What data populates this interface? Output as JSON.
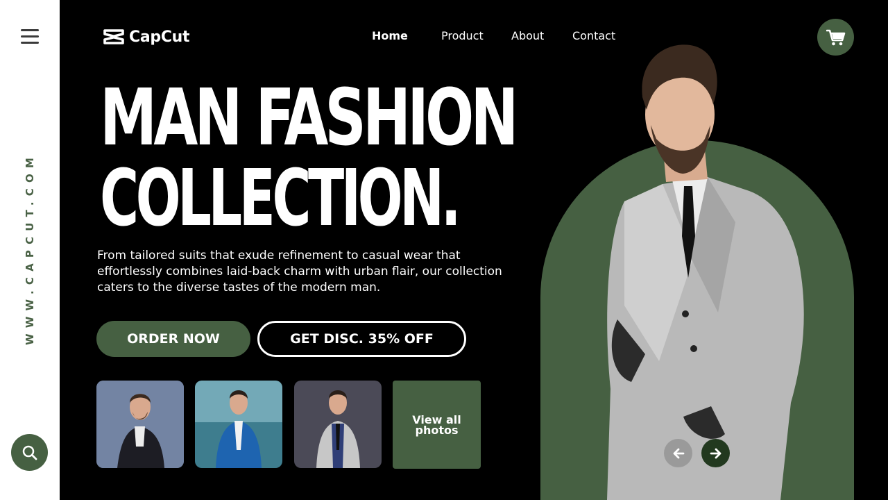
{
  "sidebar": {
    "vertical_url": "WWW.CAPCUT.COM",
    "menu_icon": "hamburger-menu-icon",
    "search_icon": "search-icon"
  },
  "header": {
    "logo_text": "CapCut",
    "nav": [
      {
        "label": "Home",
        "active": true
      },
      {
        "label": "Product",
        "active": false
      },
      {
        "label": "About",
        "active": false
      },
      {
        "label": "Contact",
        "active": false
      }
    ],
    "cart_icon": "shopping-cart-icon"
  },
  "hero": {
    "headline_line1": "MAN FASHION",
    "headline_line2": "COLLECTION.",
    "description": "From tailored suits that exude refinement to casual wear that effortlessly combines laid-back charm with urban flair, our collection caters to the diverse tastes of the modern man.",
    "order_button": "ORDER NOW",
    "discount_button": "GET DISC. 35% OFF"
  },
  "gallery": {
    "thumbnails": [
      "leather-jacket-model-photo",
      "blue-suit-model-photo",
      "grey-coat-model-photo"
    ],
    "view_all_line1": "View all",
    "view_all_line2": "photos"
  },
  "carousel": {
    "prev_icon": "arrow-left-icon",
    "next_icon": "arrow-right-icon"
  },
  "colors": {
    "accent_green": "#466042",
    "dark_green": "#22391f",
    "background": "#000000",
    "sidebar": "#ffffff"
  }
}
